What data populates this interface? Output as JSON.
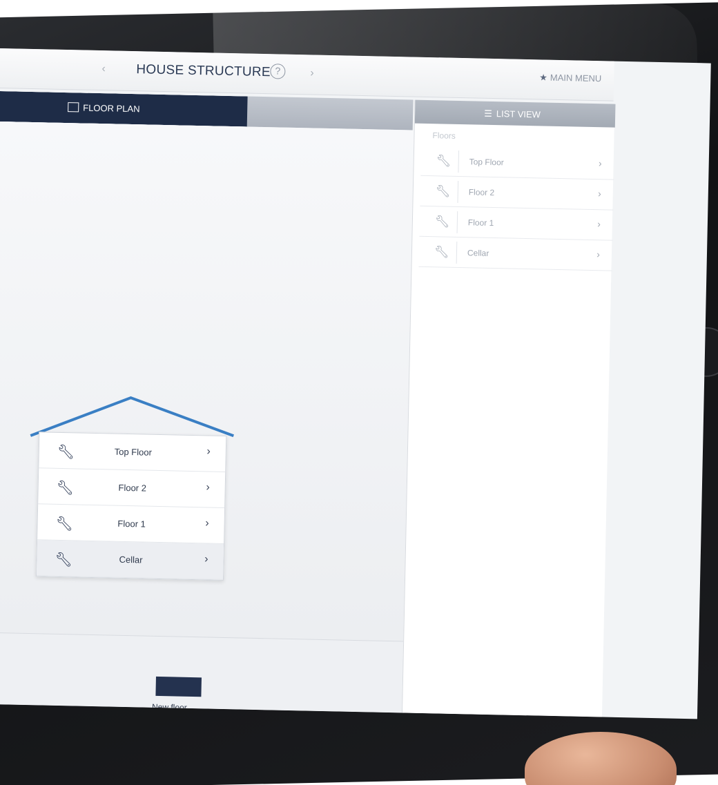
{
  "topbar": {
    "prev_glyph": "‹",
    "title": "HOUSE STRUCTURE",
    "help_glyph": "?",
    "next_glyph": "›",
    "main_menu": "MAIN MENU"
  },
  "tabs": {
    "floor_plan": "FLOOR PLAN",
    "list_view": "LIST VIEW"
  },
  "house": {
    "roof_color": "#3a7fc4",
    "floors": [
      {
        "label": "Top Floor"
      },
      {
        "label": "Floor 2"
      },
      {
        "label": "Floor 1"
      },
      {
        "label": "Cellar",
        "selected": true
      }
    ]
  },
  "list": {
    "caption": "Floors",
    "items": [
      {
        "label": "Top Floor"
      },
      {
        "label": "Floor 2"
      },
      {
        "label": "Floor 1"
      },
      {
        "label": "Cellar"
      }
    ]
  },
  "bottombar": {
    "new_floor_label": "New floor"
  },
  "colors": {
    "accent": "#1e2c47",
    "roof": "#3a7fc4"
  },
  "icons": {
    "floor_item": "wrench-icon",
    "chevron": "chevron-right-icon",
    "main_menu": "star-icon",
    "list_view": "list-icon",
    "floor_plan": "floor-plan-icon"
  }
}
